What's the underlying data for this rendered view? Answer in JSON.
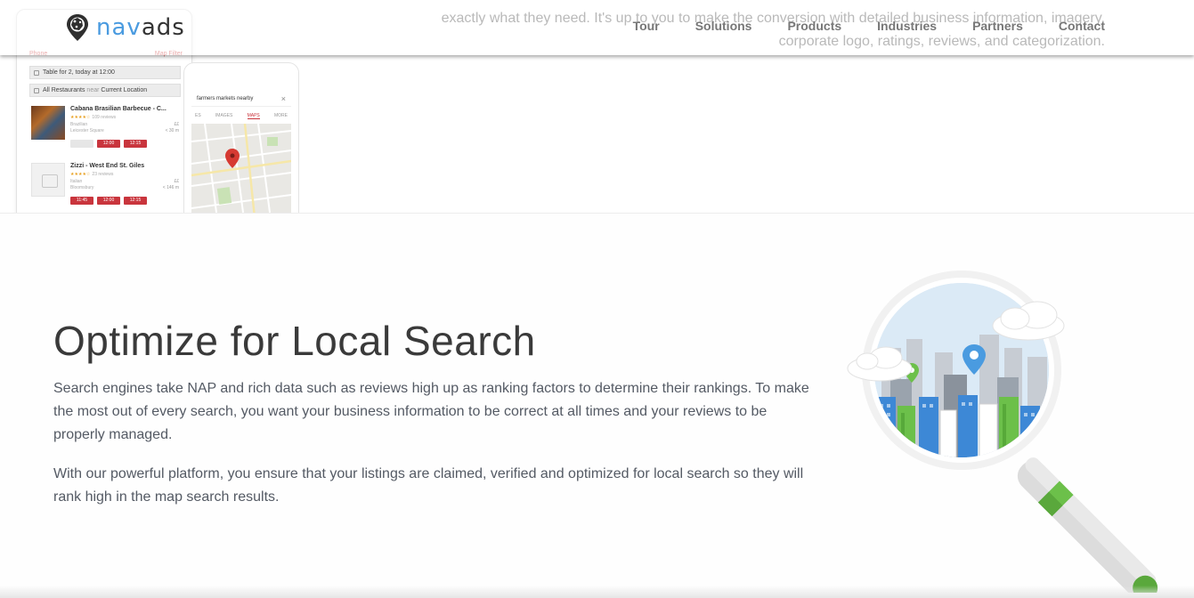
{
  "header": {
    "logo": {
      "part1": "nav",
      "part2": "ads"
    },
    "nav": [
      "Tour",
      "Solutions",
      "Products",
      "Industries",
      "Partners",
      "Contact"
    ]
  },
  "top_section": {
    "ghost_lines": [
      "exactly what they need. It's up to you to make the conversion with detailed business information, imagery,",
      "corporate logo, ratings, reviews, and categorization."
    ],
    "phone_a": {
      "link_left": "Phone",
      "link_right": "Map  Filter",
      "field_1": "Table for 2, today at 12:00",
      "field_2_pre": "All Restaurants",
      "field_2_near": "near",
      "field_2_post": "Current Location",
      "listings": [
        {
          "name": "Cabana Brasilian Barbecue - C...",
          "stars": "★★★★☆",
          "reviews": "109 reviews",
          "meta1": "Brazilian",
          "meta2": "Leicester Square",
          "price": "££",
          "dist": "< 30 m",
          "slots": [
            "",
            "12:00",
            "12:15"
          ]
        },
        {
          "name": "Zizzi - West End St. Giles",
          "stars": "★★★★☆",
          "reviews": "23 reviews",
          "meta1": "Italian",
          "meta2": "Bloomsbury",
          "price": "££",
          "dist": "< 146 m",
          "slots": [
            "11:45",
            "12:00",
            "12:15"
          ]
        }
      ]
    },
    "phone_b": {
      "search": "farmers markets nearby",
      "tabs": [
        "ES",
        "IMAGES",
        "MAPS",
        "MORE"
      ],
      "active_tab": "MAPS"
    }
  },
  "main": {
    "title": "Optimize for Local Search",
    "paragraph_1": "Search engines take NAP and rich data such as reviews high up as ranking factors to determine their rankings. To make the most out of every search, you want your business information to be correct at all times and your reviews to be properly managed.",
    "paragraph_2": "With our powerful platform, you ensure that your listings are claimed, verified and optimized for local search so they will rank high in the map search results."
  },
  "colors": {
    "brand_blue": "#4a9be0",
    "accent_red": "#c9353d",
    "green": "#6cc04a",
    "text": "#545a64"
  }
}
